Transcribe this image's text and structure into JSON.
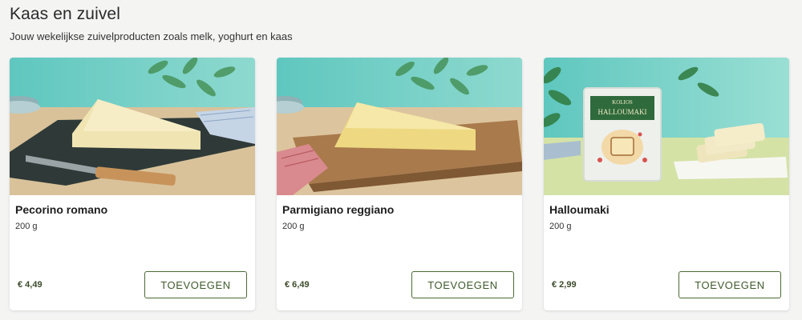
{
  "category": {
    "title": "Kaas en zuivel",
    "subtitle": "Jouw wekelijkse zuivelproducten zoals melk, yoghurt en kaas"
  },
  "products": [
    {
      "name": "Pecorino romano",
      "weight": "200 g",
      "price": "€ 4,49",
      "button": "TOEVOEGEN"
    },
    {
      "name": "Parmigiano reggiano",
      "weight": "200 g",
      "price": "€ 6,49",
      "button": "TOEVOEGEN"
    },
    {
      "name": "Halloumaki",
      "weight": "200 g",
      "price": "€ 2,99",
      "button": "TOEVOEGEN"
    }
  ],
  "package_text": {
    "brand": "KOLIOS",
    "product": "HALLOUMAKI"
  },
  "colors": {
    "accent": "#4c6a35",
    "background": "#f4f4f3",
    "card": "#ffffff"
  }
}
